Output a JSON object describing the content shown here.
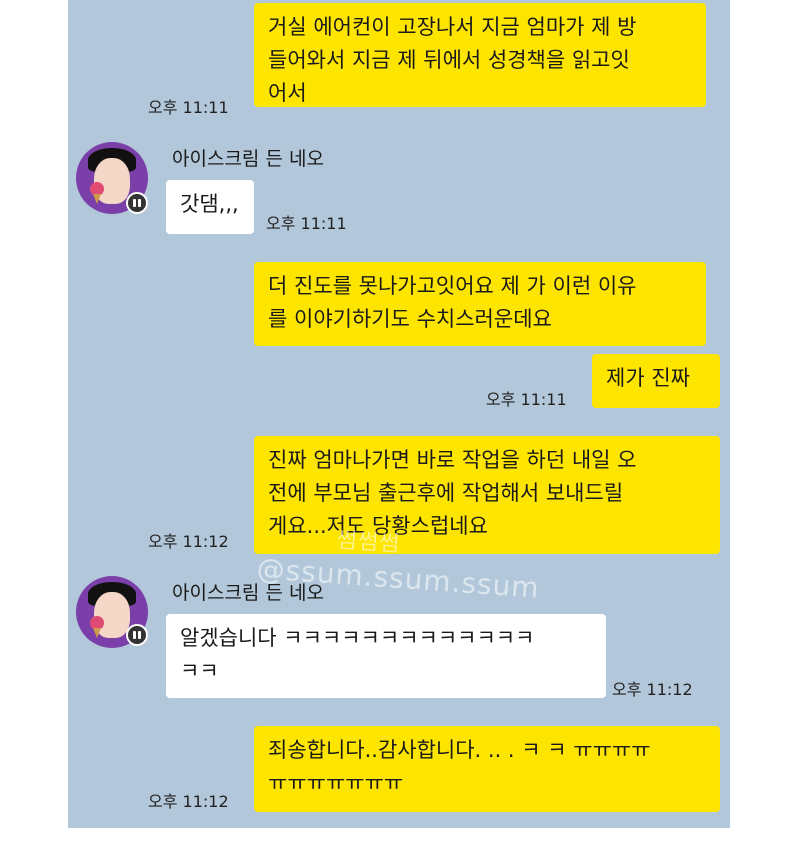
{
  "messages": [
    {
      "sender": "me",
      "text": "거실 에어컨이 고장나서 지금 엄마가 제 방\n들어와서 지금 제 뒤에서 성경책을 읽고잇\n어서",
      "time": "오후 11:11"
    },
    {
      "sender": "other",
      "name": "아이스크림 든 네오",
      "text": "갓댐,,,",
      "time": "오후 11:11"
    },
    {
      "sender": "me",
      "text": "더 진도를 못나가고잇어요 제 가 이런 이유\n를 이야기하기도 수치스러운데요"
    },
    {
      "sender": "me",
      "text": "제가 진짜",
      "time": "오후 11:11"
    },
    {
      "sender": "me",
      "text": "진짜 엄마나가면 바로 작업을 하던 내일 오\n전에 부모님 출근후에 작업해서 보내드릴\n게요...저도 당황스럽네요",
      "time": "오후 11:12"
    },
    {
      "sender": "other",
      "name": "아이스크림 든 네오",
      "text": "알겠습니다 ㅋㅋㅋㅋㅋㅋㅋㅋㅋㅋㅋㅋㅋ\nㅋㅋ",
      "time": "오후 11:12"
    },
    {
      "sender": "me",
      "text": "죄송합니다..감사합니다. .. . ㅋ ㅋ ㅠㅠㅠㅠ\nㅠㅠㅠㅠㅠㅠㅠ",
      "time": "오후 11:12"
    }
  ],
  "watermark": {
    "line1": "썸썸썸",
    "line2": "@ssum.ssum.ssum"
  },
  "colors": {
    "chat_bg": "#b2c7d9",
    "my_bubble": "#fee500",
    "other_bubble": "#ffffff",
    "avatar": "#7a3fa8"
  }
}
